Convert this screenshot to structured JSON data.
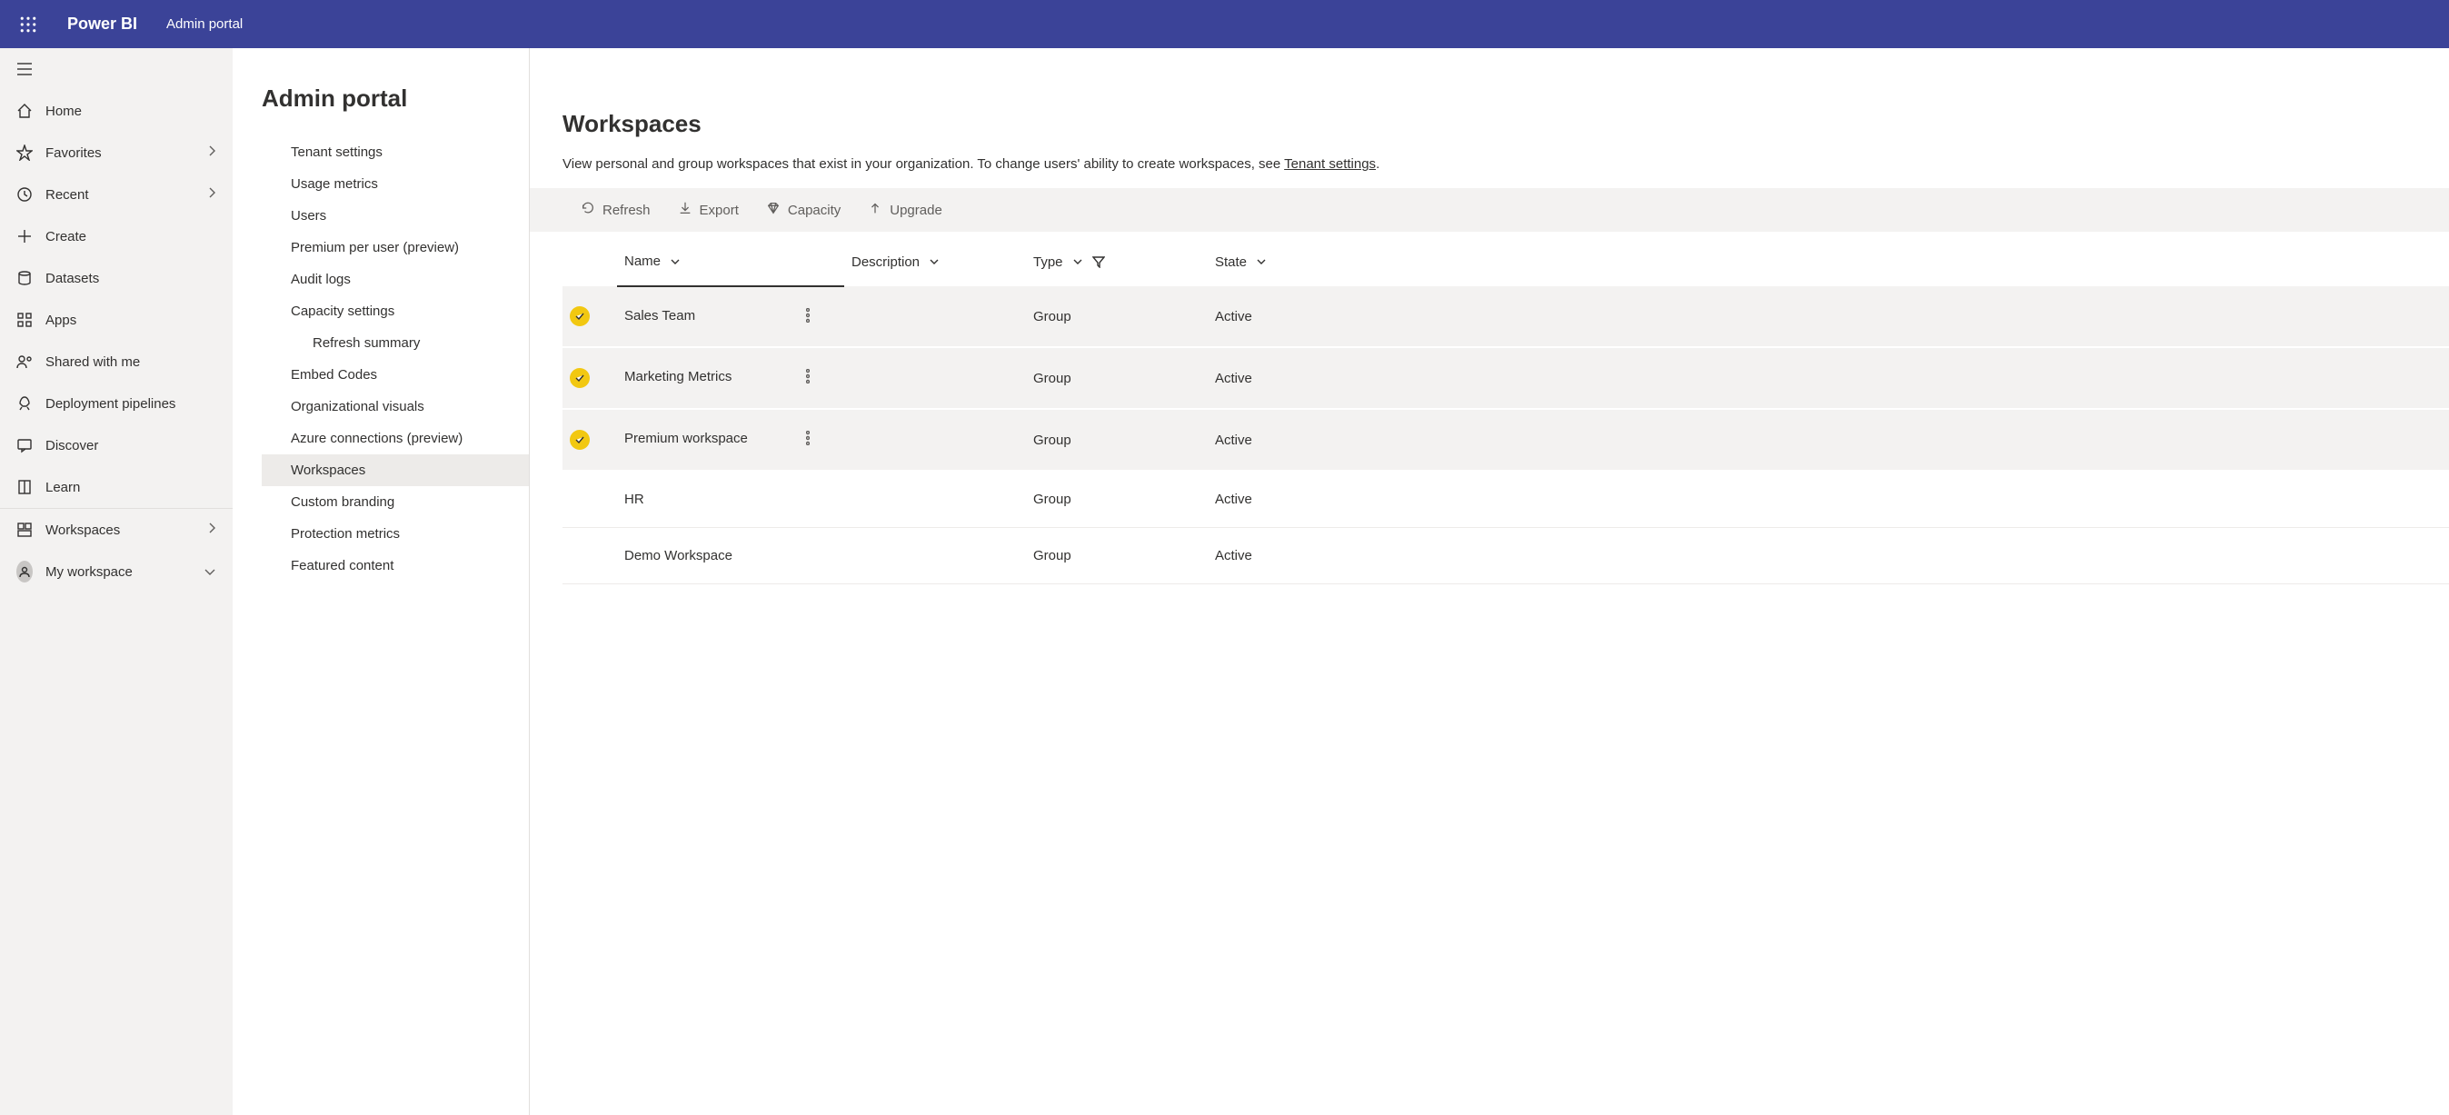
{
  "header": {
    "brand": "Power BI",
    "portal": "Admin portal"
  },
  "nav": {
    "home": "Home",
    "favorites": "Favorites",
    "recent": "Recent",
    "create": "Create",
    "datasets": "Datasets",
    "apps": "Apps",
    "shared": "Shared with me",
    "pipelines": "Deployment pipelines",
    "discover": "Discover",
    "learn": "Learn",
    "workspaces": "Workspaces",
    "myworkspace": "My workspace"
  },
  "page": {
    "title": "Admin portal",
    "submenu": {
      "tenant": "Tenant settings",
      "usage": "Usage metrics",
      "users": "Users",
      "premium": "Premium per user (preview)",
      "audit": "Audit logs",
      "capacity": "Capacity settings",
      "refresh": "Refresh summary",
      "embed": "Embed Codes",
      "orgvis": "Organizational visuals",
      "azure": "Azure connections (preview)",
      "workspaces": "Workspaces",
      "brand": "Custom branding",
      "protection": "Protection metrics",
      "featured": "Featured content"
    }
  },
  "content": {
    "heading": "Workspaces",
    "desc_prefix": "View personal and group workspaces that exist in your organization. To change users' ability to create workspaces, see ",
    "desc_link": "Tenant settings",
    "desc_suffix": ".",
    "toolbar": {
      "refresh": "Refresh",
      "export": "Export",
      "capacity": "Capacity",
      "upgrade": "Upgrade"
    },
    "columns": {
      "name": "Name",
      "description": "Description",
      "type": "Type",
      "state": "State"
    },
    "rows": [
      {
        "selected": true,
        "name": "Sales Team",
        "description": "",
        "type": "Group",
        "state": "Active"
      },
      {
        "selected": true,
        "name": "Marketing Metrics",
        "description": "",
        "type": "Group",
        "state": "Active"
      },
      {
        "selected": true,
        "name": "Premium workspace",
        "description": "",
        "type": "Group",
        "state": "Active"
      },
      {
        "selected": false,
        "name": "HR",
        "description": "",
        "type": "Group",
        "state": "Active"
      },
      {
        "selected": false,
        "name": "Demo Workspace",
        "description": "",
        "type": "Group",
        "state": "Active"
      }
    ]
  }
}
